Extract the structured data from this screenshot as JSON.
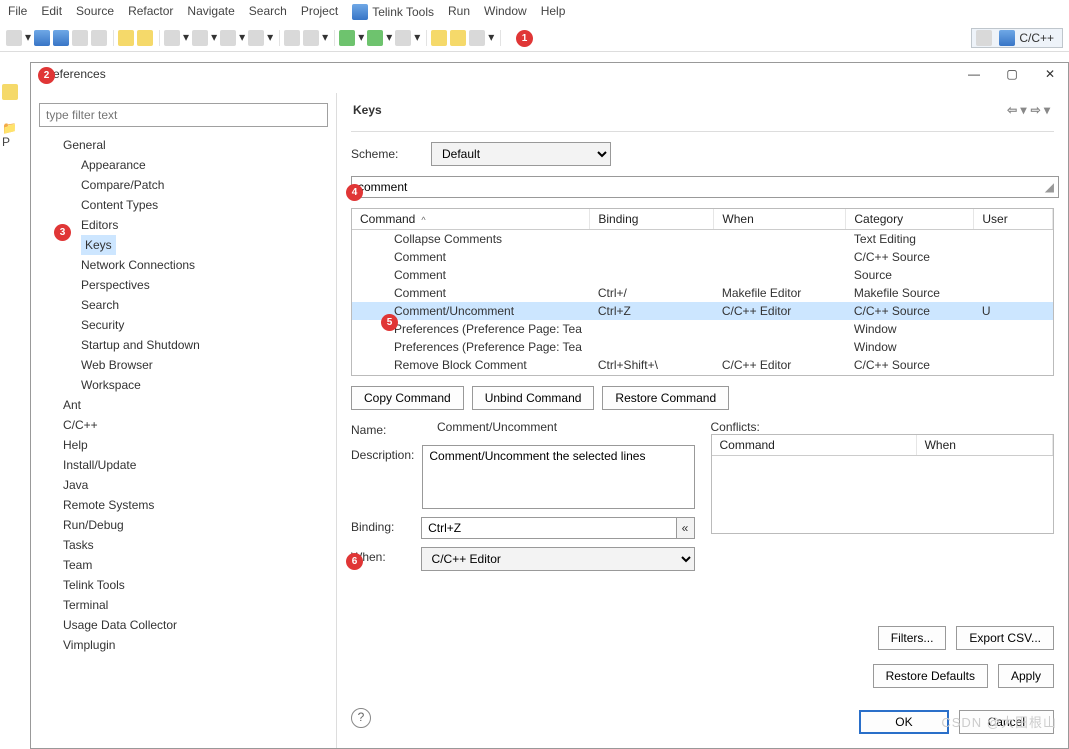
{
  "menu": [
    "File",
    "Edit",
    "Source",
    "Refactor",
    "Navigate",
    "Search",
    "Project",
    "Telink Tools",
    "Run",
    "Window",
    "Help"
  ],
  "perspective": "C/C++",
  "prefs_title": "Preferences",
  "filter_placeholder": "type filter text",
  "tree_root": "General",
  "tree_children": [
    "Appearance",
    "Compare/Patch",
    "Content Types",
    "Editors",
    "Keys",
    "Network Connections",
    "Perspectives",
    "Search",
    "Security",
    "Startup and Shutdown",
    "Web Browser",
    "Workspace"
  ],
  "tree_siblings": [
    "Ant",
    "C/C++",
    "Help",
    "Install/Update",
    "Java",
    "Remote Systems",
    "Run/Debug",
    "Tasks",
    "Team",
    "Telink Tools",
    "Terminal",
    "Usage Data Collector",
    "Vimplugin"
  ],
  "tree_selected": "Keys",
  "page_heading": "Keys",
  "scheme_label": "Scheme:",
  "scheme_value": "Default",
  "search_value": "comment",
  "columns": [
    "Command",
    "Binding",
    "When",
    "Category",
    "User"
  ],
  "rows": [
    {
      "cmd": "Collapse Comments",
      "bind": "",
      "when": "",
      "cat": "Text Editing",
      "user": ""
    },
    {
      "cmd": "Comment",
      "bind": "",
      "when": "",
      "cat": "C/C++ Source",
      "user": ""
    },
    {
      "cmd": "Comment",
      "bind": "",
      "when": "",
      "cat": "Source",
      "user": ""
    },
    {
      "cmd": "Comment",
      "bind": "Ctrl+/",
      "when": "Makefile Editor",
      "cat": "Makefile Source",
      "user": ""
    },
    {
      "cmd": "Comment/Uncomment",
      "bind": "Ctrl+Z",
      "when": "C/C++ Editor",
      "cat": "C/C++ Source",
      "user": "U",
      "sel": true
    },
    {
      "cmd": "Preferences (Preference Page: Tea",
      "bind": "",
      "when": "",
      "cat": "Window",
      "user": ""
    },
    {
      "cmd": "Preferences (Preference Page: Tea",
      "bind": "",
      "when": "",
      "cat": "Window",
      "user": ""
    },
    {
      "cmd": "Remove Block Comment",
      "bind": "Ctrl+Shift+\\",
      "when": "C/C++ Editor",
      "cat": "C/C++ Source",
      "user": ""
    }
  ],
  "btn_copy": "Copy Command",
  "btn_unbind": "Unbind Command",
  "btn_restore": "Restore Command",
  "name_label": "Name:",
  "name_value": "Comment/Uncomment",
  "desc_label": "Description:",
  "desc_value": "Comment/Uncomment the selected lines",
  "bind_label": "Binding:",
  "bind_value": "Ctrl+Z",
  "when_label": "When:",
  "when_value": "C/C++ Editor",
  "conflicts_label": "Conflicts:",
  "conflicts_cols": [
    "Command",
    "When"
  ],
  "btn_filters": "Filters...",
  "btn_export": "Export CSV...",
  "btn_defaults": "Restore Defaults",
  "btn_apply": "Apply",
  "btn_ok": "OK",
  "btn_cancel": "Cancel",
  "watermark": "CSDN @大田根山",
  "annots": [
    "1",
    "2",
    "3",
    "4",
    "5",
    "6"
  ]
}
